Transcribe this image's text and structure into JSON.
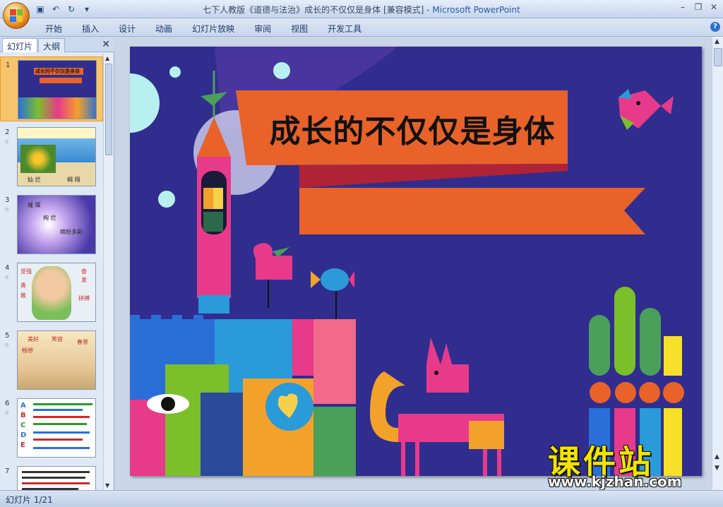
{
  "window": {
    "title_doc": "七下人教版《道德与法治》成长的不仅仅是身体 [兼容模式]",
    "title_sep": " - ",
    "title_app": "Microsoft PowerPoint",
    "controls": [
      "–",
      "❐",
      "✕"
    ]
  },
  "ribbon": {
    "tabs": [
      "开始",
      "插入",
      "设计",
      "动画",
      "幻灯片放映",
      "审阅",
      "视图",
      "开发工具"
    ],
    "help": "?"
  },
  "panel": {
    "tabs": [
      "幻灯片",
      "大纲"
    ],
    "close": "✕",
    "slides": [
      {
        "num": "1",
        "labels": [
          "成长的不仅仅是身体"
        ]
      },
      {
        "num": "2",
        "labels": [
          "灿 烂",
          "翱 翔"
        ]
      },
      {
        "num": "3",
        "labels": [
          "璀 璨",
          "绚 烂",
          "缤纷多彩"
        ]
      },
      {
        "num": "4",
        "labels": [
          "坚强",
          "奋",
          "勇",
          "发",
          "敢",
          "拼搏"
        ]
      },
      {
        "num": "5",
        "labels": [
          "美好",
          "笑容",
          "春景",
          "畅想"
        ]
      },
      {
        "num": "6",
        "labels": [
          "A",
          "B",
          "C",
          "D",
          "E"
        ]
      },
      {
        "num": "7",
        "labels": []
      }
    ]
  },
  "slide": {
    "title": "成长的不仅仅是身体",
    "colors": {
      "background": "#302d8e",
      "banner": "#e8622a",
      "banner_shadow": "#b02336"
    }
  },
  "watermark": {
    "text": "课件站",
    "url": "www.kjzhan.com"
  },
  "status": {
    "slide_counter": "幻灯片 1/21"
  }
}
